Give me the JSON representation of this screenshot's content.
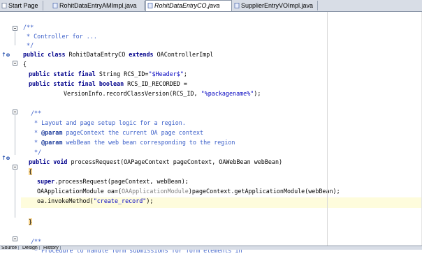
{
  "tabs": [
    {
      "label": "Start Page",
      "active": false
    },
    {
      "label": "RohitDataEntryAMImpl.java",
      "active": false
    },
    {
      "label": "RohitDataEntryCO.java",
      "active": true
    },
    {
      "label": "SupplierEntryVOImpl.java",
      "active": false
    }
  ],
  "code": {
    "l1": "/**",
    "l2": " * Controller for ...",
    "l3": " */",
    "l4_kw1": "public class",
    "l4_a": " RohitDataEntryCO ",
    "l4_kw2": "extends",
    "l4_b": " OAControllerImpl",
    "l5": "{",
    "l6_kw": "public static final",
    "l6_a": " String RCS_ID=",
    "l6_str": "\"$Header$\"",
    "l6_b": ";",
    "l7_kw": "public static final boolean",
    "l7_a": " RCS_ID_RECORDED =",
    "l8_a": "VersionInfo.recordClassVersion(RCS_ID, ",
    "l8_str": "\"%packagename%\"",
    "l8_b": ");",
    "l9": "/**",
    "l10": " * Layout and page setup logic for a region.",
    "l11_a": " * ",
    "l11_tag": "@param",
    "l11_b": " pageContext the current OA page context",
    "l12_a": " * ",
    "l12_tag": "@param",
    "l12_b": " webBean the web bean corresponding to the region",
    "l13": " */",
    "l14_kw": "public void",
    "l14_a": " processRequest(OAPageContext pageContext, OAWebBean webBean)",
    "l15": "{",
    "l16_kw": "super",
    "l16_a": ".processRequest(pageContext, webBean);",
    "l17_a": "OAApplicationModule oa=(",
    "l17_cast": "OAApplicationModule",
    "l17_b": ")pageContext.getApplicationModule(webBean);",
    "l18_a": "oa.invokeMethod(",
    "l18_str": "\"create_record\"",
    "l18_b": ");",
    "l20": "}",
    "l22": "/**",
    "l23": " * Procedure to handle form submissions for form elements in"
  },
  "markers": {
    "override": "↑o"
  },
  "bottom_tabs": [
    "Source",
    "Design",
    "History"
  ]
}
